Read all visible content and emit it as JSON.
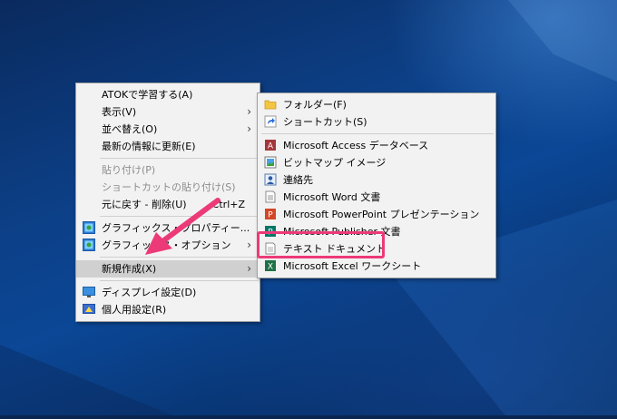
{
  "context_menu": {
    "items": [
      {
        "label": "ATOKで学習する(A)"
      },
      {
        "label": "表示(V)"
      },
      {
        "label": "並べ替え(O)"
      },
      {
        "label": "最新の情報に更新(E)"
      },
      {
        "label": "貼り付け(P)"
      },
      {
        "label": "ショートカットの貼り付け(S)"
      },
      {
        "label": "元に戻す - 削除(U)",
        "shortcut": "Ctrl+Z"
      },
      {
        "label": "グラフィックス・プロパティー...",
        "icon": "intel-graphics-icon"
      },
      {
        "label": "グラフィックス・オプション",
        "icon": "intel-graphics-icon"
      },
      {
        "label": "新規作成(X)"
      },
      {
        "label": "ディスプレイ設定(D)",
        "icon": "display-icon"
      },
      {
        "label": "個人用設定(R)",
        "icon": "personalize-icon"
      }
    ]
  },
  "submenu": {
    "items": [
      {
        "label": "フォルダー(F)",
        "icon": "folder-icon"
      },
      {
        "label": "ショートカット(S)",
        "icon": "shortcut-icon"
      },
      {
        "label": "Microsoft Access データベース",
        "icon": "access-icon"
      },
      {
        "label": "ビットマップ イメージ",
        "icon": "bitmap-icon"
      },
      {
        "label": "連絡先",
        "icon": "contact-icon"
      },
      {
        "label": "Microsoft Word 文書",
        "icon": "word-icon"
      },
      {
        "label": "Microsoft PowerPoint プレゼンテーション",
        "icon": "powerpoint-icon"
      },
      {
        "label": "Microsoft Publisher 文書",
        "icon": "publisher-icon"
      },
      {
        "label": "テキスト ドキュメント",
        "icon": "text-document-icon"
      },
      {
        "label": "Microsoft Excel ワークシート",
        "icon": "excel-icon"
      }
    ]
  },
  "colors": {
    "highlight": "#ec3a78",
    "menu_bg": "#f2f2f2",
    "desktop": "#0c3f86"
  }
}
